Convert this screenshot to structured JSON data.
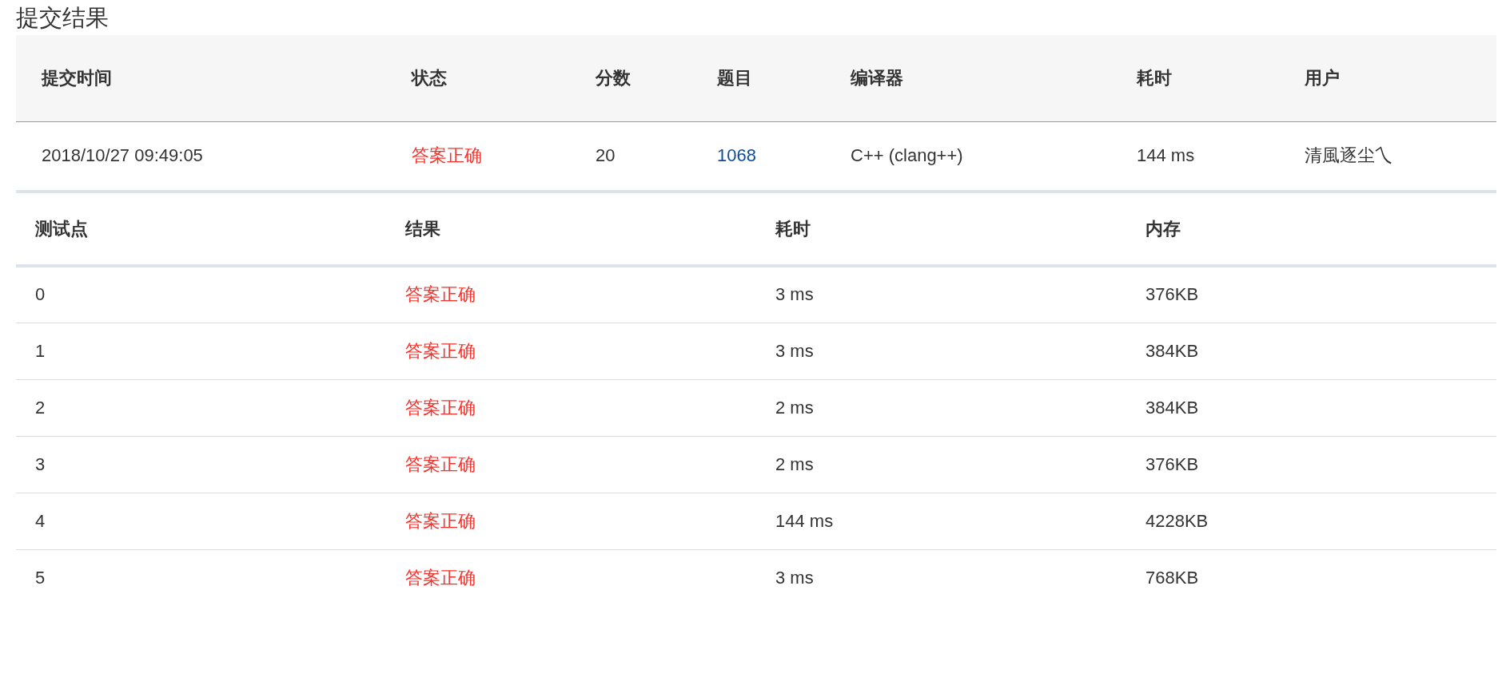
{
  "title": "提交结果",
  "submission": {
    "columns": [
      "提交时间",
      "状态",
      "分数",
      "题目",
      "编译器",
      "耗时",
      "用户"
    ],
    "rows": [
      {
        "cells": [
          {
            "kind": "text",
            "text": "2018/10/27 09:49:05"
          },
          {
            "kind": "status",
            "text": "答案正确"
          },
          {
            "kind": "text",
            "text": "20"
          },
          {
            "kind": "link",
            "text": "1068"
          },
          {
            "kind": "text",
            "text": "C++ (clang++)"
          },
          {
            "kind": "text",
            "text": "144 ms"
          },
          {
            "kind": "text",
            "text": "清風逐尘乀"
          }
        ]
      }
    ]
  },
  "testpoints": {
    "columns": [
      "测试点",
      "结果",
      "耗时",
      "内存"
    ],
    "rows": [
      {
        "cells": [
          {
            "kind": "text",
            "text": "0"
          },
          {
            "kind": "status",
            "text": "答案正确"
          },
          {
            "kind": "text",
            "text": "3 ms"
          },
          {
            "kind": "text",
            "text": "376KB"
          }
        ]
      },
      {
        "cells": [
          {
            "kind": "text",
            "text": "1"
          },
          {
            "kind": "status",
            "text": "答案正确"
          },
          {
            "kind": "text",
            "text": "3 ms"
          },
          {
            "kind": "text",
            "text": "384KB"
          }
        ]
      },
      {
        "cells": [
          {
            "kind": "text",
            "text": "2"
          },
          {
            "kind": "status",
            "text": "答案正确"
          },
          {
            "kind": "text",
            "text": "2 ms"
          },
          {
            "kind": "text",
            "text": "384KB"
          }
        ]
      },
      {
        "cells": [
          {
            "kind": "text",
            "text": "3"
          },
          {
            "kind": "status",
            "text": "答案正确"
          },
          {
            "kind": "text",
            "text": "2 ms"
          },
          {
            "kind": "text",
            "text": "376KB"
          }
        ]
      },
      {
        "cells": [
          {
            "kind": "text",
            "text": "4"
          },
          {
            "kind": "status",
            "text": "答案正确"
          },
          {
            "kind": "text",
            "text": "144 ms"
          },
          {
            "kind": "text",
            "text": "4228KB"
          }
        ]
      },
      {
        "cells": [
          {
            "kind": "text",
            "text": "5"
          },
          {
            "kind": "status",
            "text": "答案正确"
          },
          {
            "kind": "text",
            "text": "3 ms"
          },
          {
            "kind": "text",
            "text": "768KB"
          }
        ]
      }
    ]
  }
}
